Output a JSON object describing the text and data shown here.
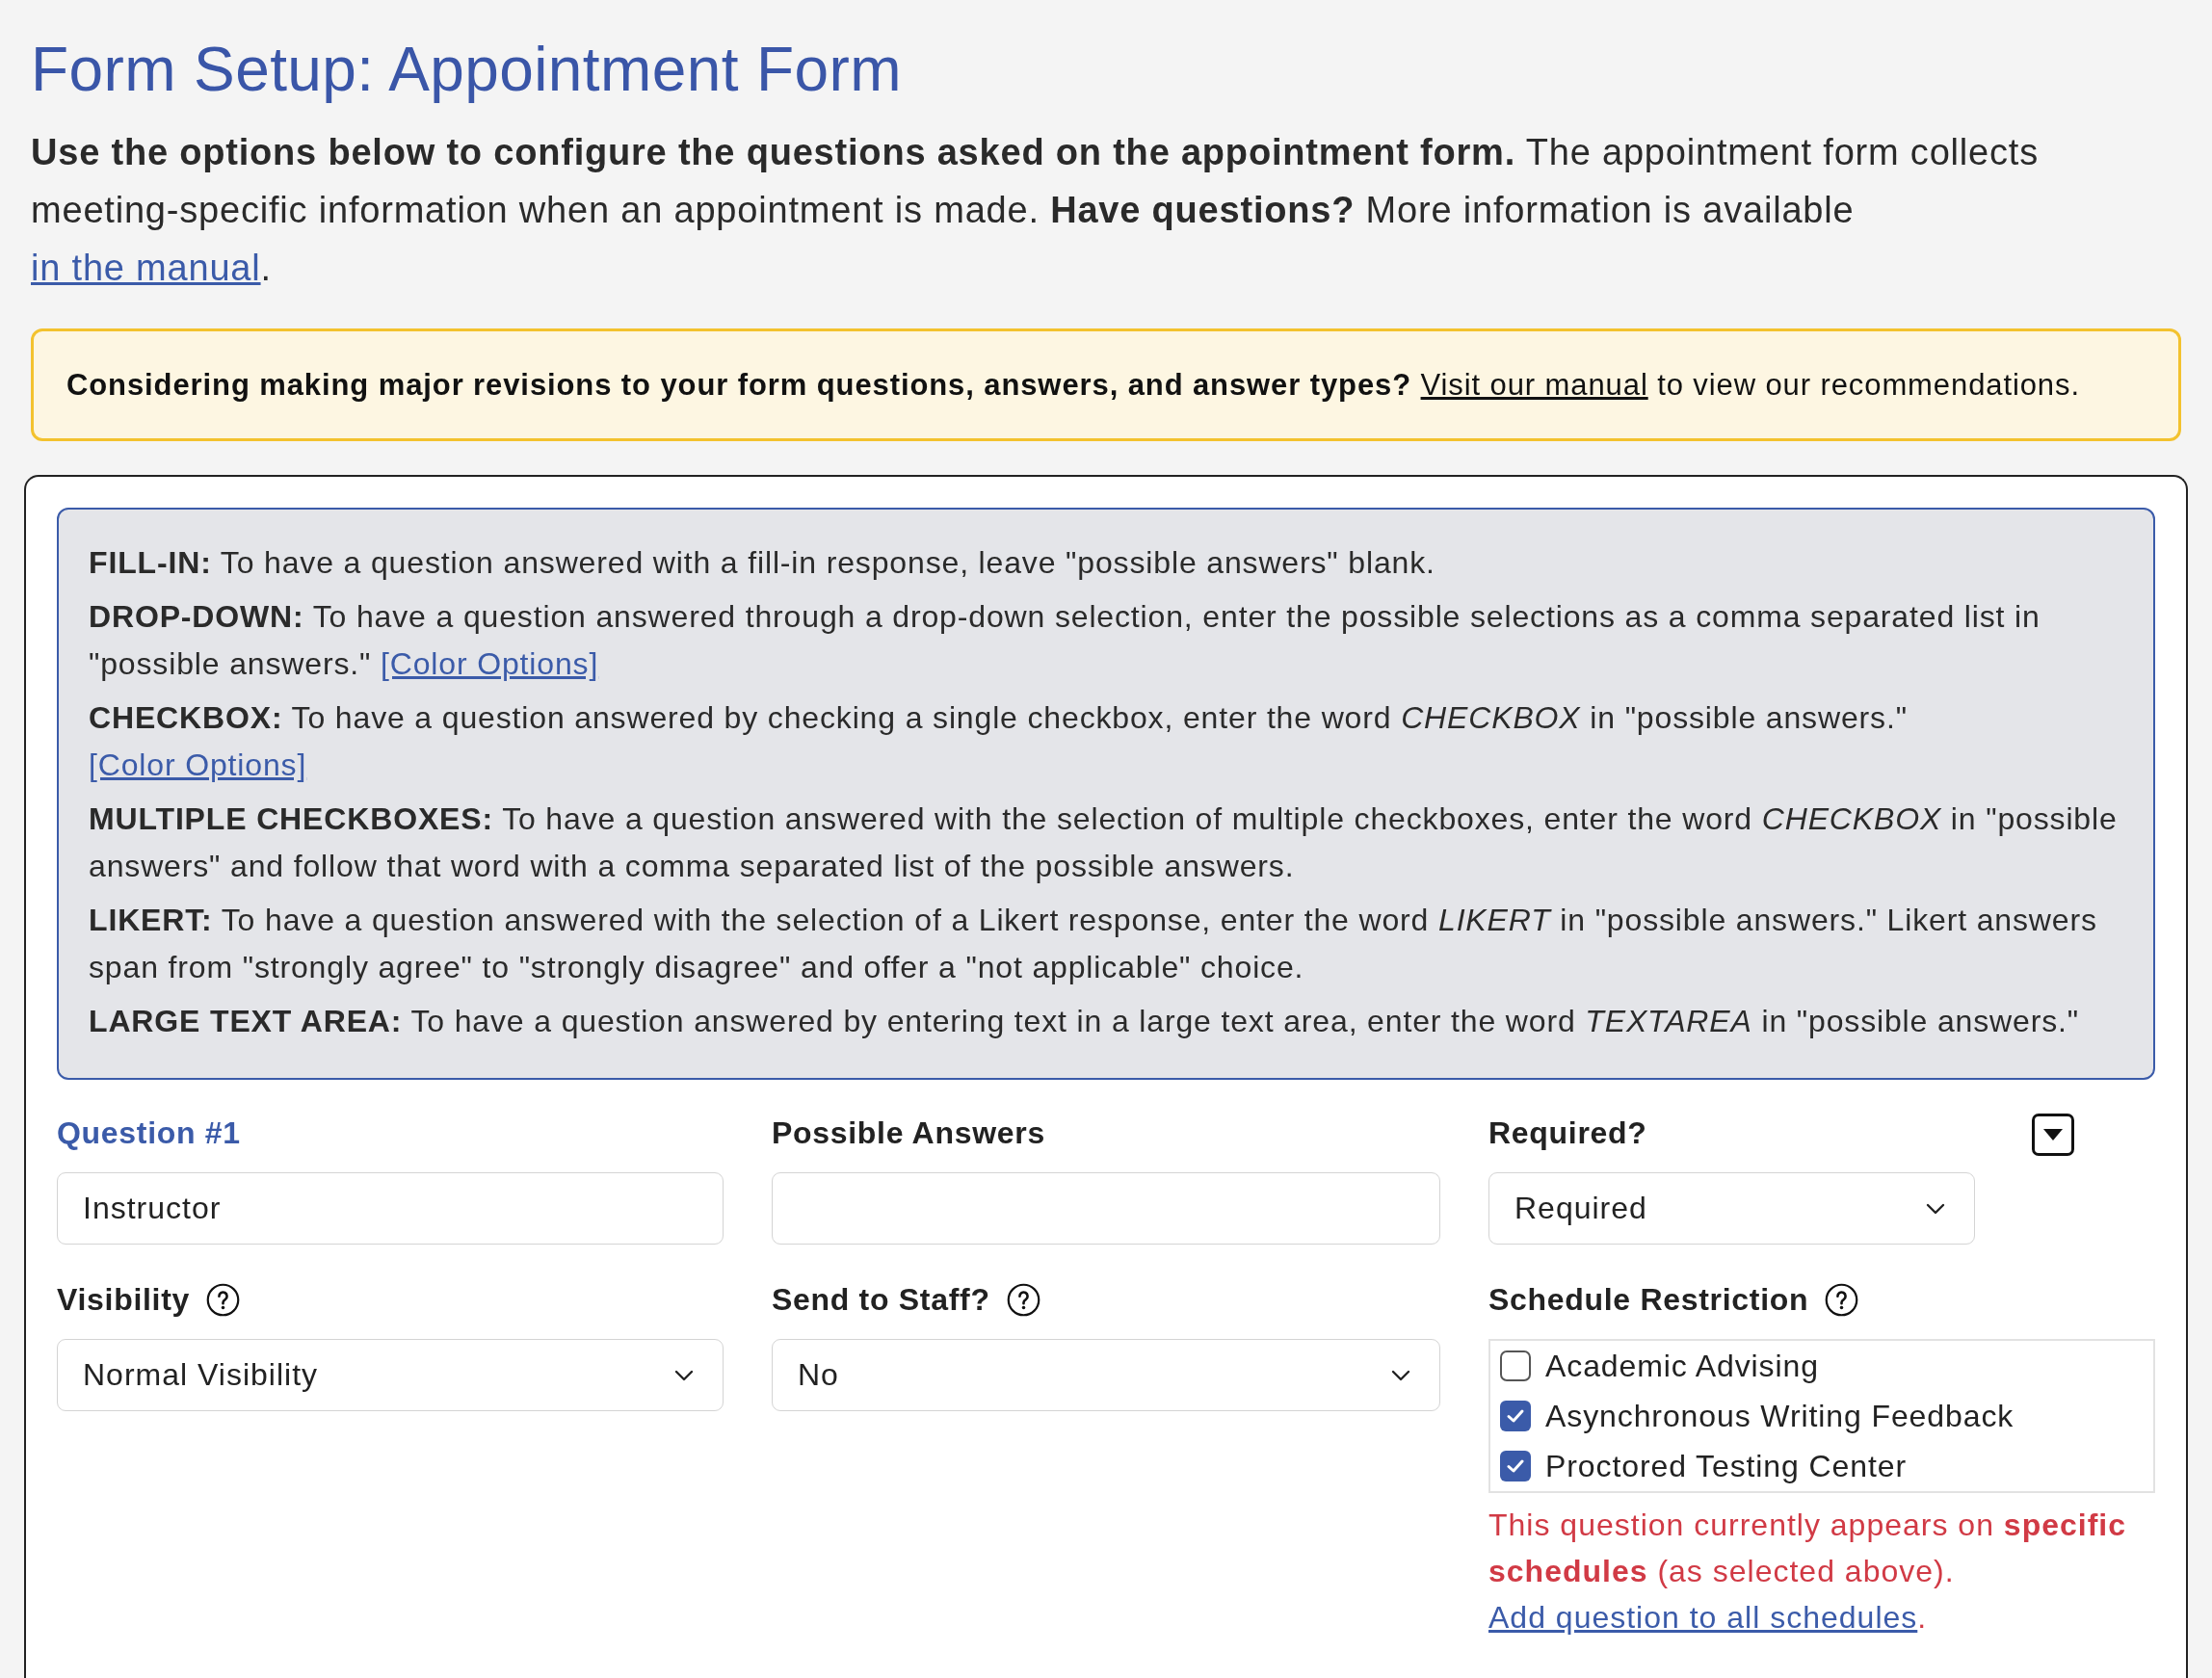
{
  "page": {
    "title": "Form Setup: Appointment Form"
  },
  "intro": {
    "text": "**Use the options below to configure the questions asked on the appointment form.** The appointment form collects meeting-specific information when an appointment is made. **Have questions?** More information is available",
    "link": "in the manual",
    "end": "."
  },
  "notice": {
    "text": "**Considering making major revisions to your form questions, answers, and answer types?**",
    "link": "Visit our manual",
    "end": "to view our recommendations."
  },
  "answer_types": [
    {
      "text": "**FILL-IN:** To have a question answered with a fill-in response, leave \"possible answers\" blank."
    },
    {
      "text": "**DROP-DOWN:** To have a question answered through a drop-down selection, enter the possible selections as a comma separated list in \"possible answers.\"",
      "link": "[Color Options]"
    },
    {
      "text": "**CHECKBOX:** To have a question answered by checking a single checkbox, enter the word *CHECKBOX* in \"possible answers.\"",
      "link": "[Color Options]"
    },
    {
      "text": "**MULTIPLE CHECKBOXES:** To have a question answered with the selection of multiple checkboxes, enter the word *CHECKBOX* in \"possible answers\" and follow that word with a comma separated list of the possible answers."
    },
    {
      "text": "**LIKERT:** To have a question answered with the selection of a Likert response, enter the word *LIKERT* in \"possible answers.\" Likert answers span from \"strongly agree\" to \"strongly disagree\" and offer a \"not applicable\" choice."
    },
    {
      "text": "**LARGE TEXT AREA:** To have a question answered by entering text in a large text area, enter the word *TEXTAREA* in \"possible answers.\""
    }
  ],
  "question": {
    "fields": [
      {
        "kind": "text",
        "label": "Question #1",
        "accent": true,
        "help": false,
        "value": "Instructor"
      },
      {
        "kind": "text",
        "label": "Possible Answers",
        "accent": false,
        "help": false
      },
      {
        "kind": "select",
        "label": "Required?",
        "accent": false,
        "help": false,
        "value": "Required"
      },
      {
        "kind": "select",
        "label": "Visibility",
        "accent": false,
        "help": true,
        "value": "Normal Visibility"
      },
      {
        "kind": "select",
        "label": "Send to Staff?",
        "accent": false,
        "help": true,
        "value": "No"
      },
      {
        "kind": "checklist",
        "label": "Schedule Restriction",
        "accent": false,
        "help": true,
        "options": [
          {
            "label": "Academic Advising",
            "checked": false
          },
          {
            "label": "Asynchronous Writing Feedback",
            "checked": true
          },
          {
            "label": "Proctored Testing Center",
            "checked": true
          }
        ],
        "note": {
          "text": "This question currently appears on **specific schedules** (as selected above).",
          "link": "Add question to all schedules",
          "end": "."
        }
      }
    ]
  }
}
